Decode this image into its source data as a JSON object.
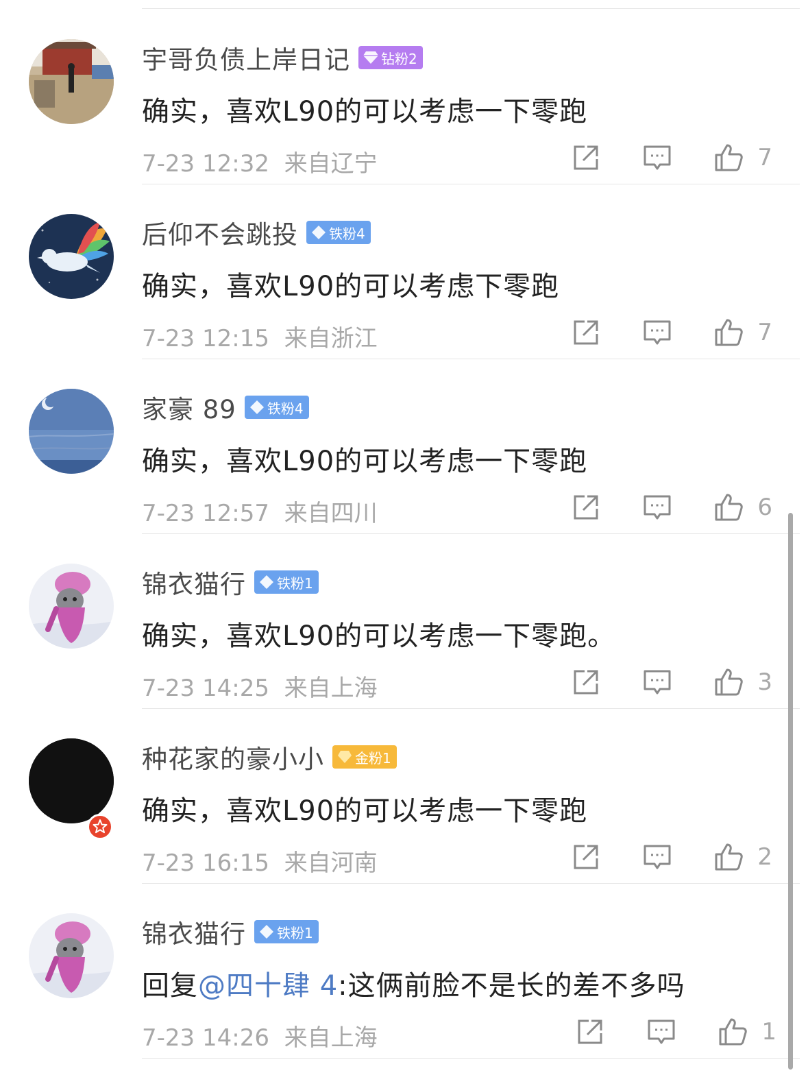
{
  "comments": [
    {
      "username": "宇哥负债上岸日记",
      "badge": {
        "label": "钻粉2",
        "tier": "zuan",
        "color": "#b57cf0"
      },
      "text": "确实，喜欢L90的可以考虑一下零跑",
      "time": "7-23 12:32",
      "location": "来自辽宁",
      "likes": "7",
      "avatar": "photo-square-avatar"
    },
    {
      "username": "后仰不会跳投",
      "badge": {
        "label": "铁粉4",
        "tier": "tie",
        "color": "#6aa2ee"
      },
      "text": "确实，喜欢L90的可以考虑下零跑",
      "time": "7-23 12:15",
      "location": "来自浙江",
      "likes": "7",
      "avatar": "rainbow-bird-avatar"
    },
    {
      "username": "家豪 89",
      "badge": {
        "label": "铁粉4",
        "tier": "tie",
        "color": "#6aa2ee"
      },
      "text": "确实，喜欢L90的可以考虑一下零跑",
      "time": "7-23 12:57",
      "location": "来自四川",
      "likes": "6",
      "avatar": "moon-sky-avatar"
    },
    {
      "username": "锦衣猫行",
      "badge": {
        "label": "铁粉1",
        "tier": "tie",
        "color": "#6aa2ee"
      },
      "text": "确实，喜欢L90的可以考虑一下零跑。",
      "time": "7-23 14:25",
      "location": "来自上海",
      "likes": "3",
      "avatar": "pink-cat-avatar"
    },
    {
      "username": "种花家的豪小小",
      "badge": {
        "label": "金粉1",
        "tier": "jin",
        "color": "#f7b93a"
      },
      "text": "确实，喜欢L90的可以考虑一下零跑",
      "time": "7-23 16:15",
      "location": "来自河南",
      "likes": "2",
      "avatar": "black-avatar",
      "verified": true
    },
    {
      "username": "锦衣猫行",
      "badge": {
        "label": "铁粉1",
        "tier": "tie",
        "color": "#6aa2ee"
      },
      "reply_prefix": "回复",
      "mention": "@四十肆 4",
      "reply_text": ":这俩前脸不是长的差不多吗",
      "time": "7-23 14:26",
      "location": "来自上海",
      "likes": "1",
      "avatar": "pink-cat-avatar"
    }
  ]
}
